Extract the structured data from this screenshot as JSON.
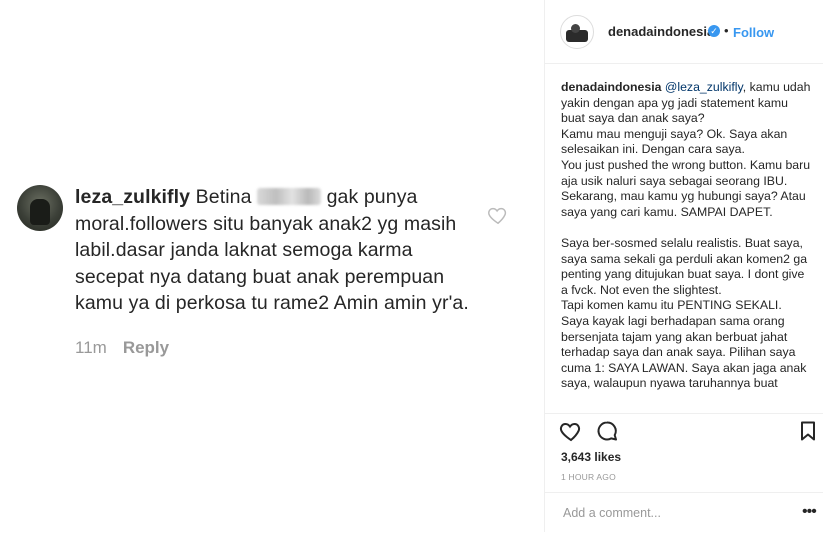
{
  "comment": {
    "username": "leza_zulkifly",
    "text_before_blur": "Betina",
    "text_after_blur": "gak punya moral.followers situ banyak anak2 yg masih labil.dasar janda laknat semoga karma secepat nya datang buat anak perempuan kamu ya di perkosa tu rame2 Amin amin yr'a.",
    "time": "11m",
    "reply_label": "Reply"
  },
  "post": {
    "username": "denadaindonesia",
    "dot": "•",
    "follow_label": "Follow",
    "caption_user": "denadaindonesia",
    "caption_mention": "@leza_zulkifly",
    "caption_paragraphs": [
      ", kamu udah yakin dengan apa yg jadi statement kamu buat saya dan anak saya?",
      "Kamu mau menguji saya? Ok. Saya akan selesaikan ini. Dengan cara saya.",
      "You just pushed the wrong button. Kamu baru aja usik naluri saya sebagai seorang IBU.",
      "Sekarang, mau kamu yg hubungi saya? Atau saya yang cari kamu. SAMPAI DAPET.",
      "",
      "Saya ber-sosmed selalu realistis. Buat saya, saya sama sekali ga perduli akan komen2 ga penting yang ditujukan buat saya. I dont give a fvck. Not even the slightest.",
      "Tapi komen kamu itu PENTING SEKALI.",
      "Saya kayak lagi berhadapan sama orang bersenjata tajam yang akan berbuat jahat terhadap saya dan anak saya. Pilihan saya cuma 1: SAYA LAWAN. Saya akan jaga anak saya, walaupun nyawa taruhannya buat"
    ],
    "likes": "3,643 likes",
    "time_ago": "1 HOUR AGO",
    "add_comment_placeholder": "Add a comment...",
    "more_label": "•••"
  },
  "icons": {
    "comment_like": "heart-outline-icon",
    "like": "heart-outline-icon",
    "comment": "speech-bubble-icon",
    "save": "bookmark-icon",
    "verified": "verified-badge-icon"
  },
  "colors": {
    "link": "#3897f0",
    "text": "#262626",
    "muted": "#999999",
    "border": "#efefef"
  }
}
